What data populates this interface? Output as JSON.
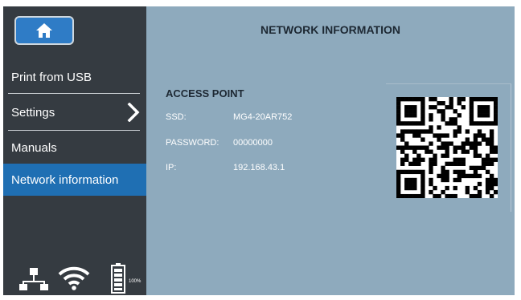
{
  "sidebar": {
    "home_icon": "home-icon",
    "items": [
      {
        "label": "Print from USB",
        "active": false
      },
      {
        "label": "Settings",
        "active": false,
        "has_chevron": true
      },
      {
        "label": "Manuals",
        "active": false
      },
      {
        "label": "Network information",
        "active": true
      }
    ],
    "status": {
      "network_icon": "network-icon",
      "wifi_icon": "wifi-icon",
      "battery_icon": "battery-icon",
      "battery_label": "100%"
    }
  },
  "main": {
    "title": "NETWORK INFORMATION",
    "section_title": "ACCESS POINT",
    "fields": [
      {
        "label": "SSD:",
        "value": "MG4-20AR752"
      },
      {
        "label": "PASSWORD:",
        "value": "00000000"
      },
      {
        "label": "IP:",
        "value": "192.168.43.1"
      }
    ],
    "qr_icon": "qr-code"
  },
  "colors": {
    "sidebar_bg": "#353b41",
    "content_bg": "#8eaabd",
    "active_item": "#1f6fb3",
    "home_button": "#2f7cc6"
  }
}
